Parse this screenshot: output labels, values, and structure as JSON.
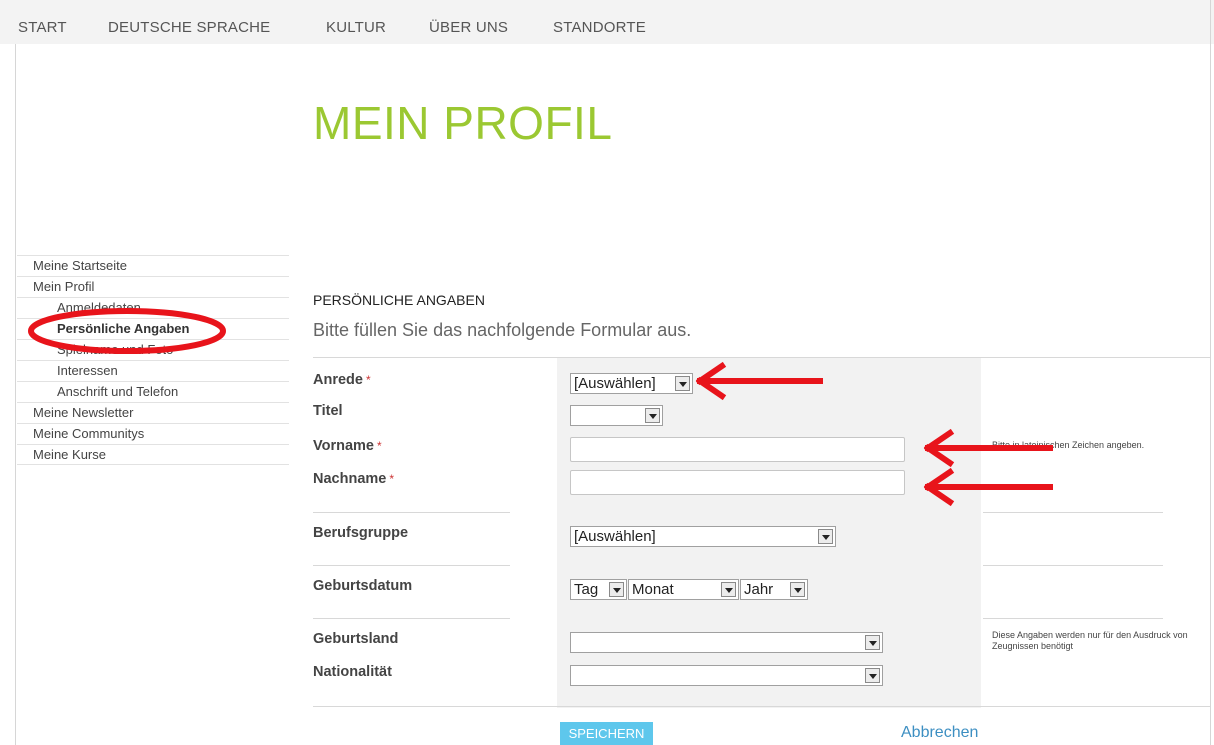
{
  "topnav": {
    "items": [
      {
        "label": "START"
      },
      {
        "label": "DEUTSCHE SPRACHE"
      },
      {
        "label": "KULTUR"
      },
      {
        "label": "ÜBER UNS"
      },
      {
        "label": "STANDORTE"
      }
    ]
  },
  "page_title": "MEIN PROFIL",
  "sidebar": {
    "items": [
      {
        "label": "Meine Startseite"
      },
      {
        "label": "Mein Profil"
      },
      {
        "label": "Anmeldedaten"
      },
      {
        "label": "Persönliche Angaben"
      },
      {
        "label": "Spielname und Foto"
      },
      {
        "label": "Interessen"
      },
      {
        "label": "Anschrift und Telefon"
      },
      {
        "label": "Meine Newsletter"
      },
      {
        "label": "Meine Communitys"
      },
      {
        "label": "Meine Kurse"
      }
    ],
    "active_item": "Persönliche Angaben"
  },
  "section": {
    "heading": "PERSÖNLICHE ANGABEN",
    "intro": "Bitte füllen Sie das nachfolgende Formular aus."
  },
  "form": {
    "required_marker": "*",
    "anrede": {
      "label": "Anrede",
      "value": "[Auswählen]"
    },
    "titel": {
      "label": "Titel",
      "value": ""
    },
    "vorname": {
      "label": "Vorname",
      "value": "",
      "hint": "Bitte in lateinischen Zeichen angeben."
    },
    "nachname": {
      "label": "Nachname",
      "value": ""
    },
    "berufsgruppe": {
      "label": "Berufsgruppe",
      "value": "[Auswählen]"
    },
    "geburtsdatum": {
      "label": "Geburtsdatum",
      "day": "Tag",
      "month": "Monat",
      "year": "Jahr"
    },
    "geburtsland": {
      "label": "Geburtsland",
      "value": ""
    },
    "nationalitaet": {
      "label": "Nationalität",
      "value": ""
    },
    "print_hint": "Diese Angaben werden nur für den Ausdruck von Zeugnissen benötigt"
  },
  "actions": {
    "save_label": "SPEICHERN",
    "cancel_label": "Abbrechen"
  },
  "colors": {
    "title_green": "#9bc832",
    "save_blue": "#5ec7ec",
    "link_blue": "#3d8fc2",
    "annotation_red": "#e8141b"
  }
}
